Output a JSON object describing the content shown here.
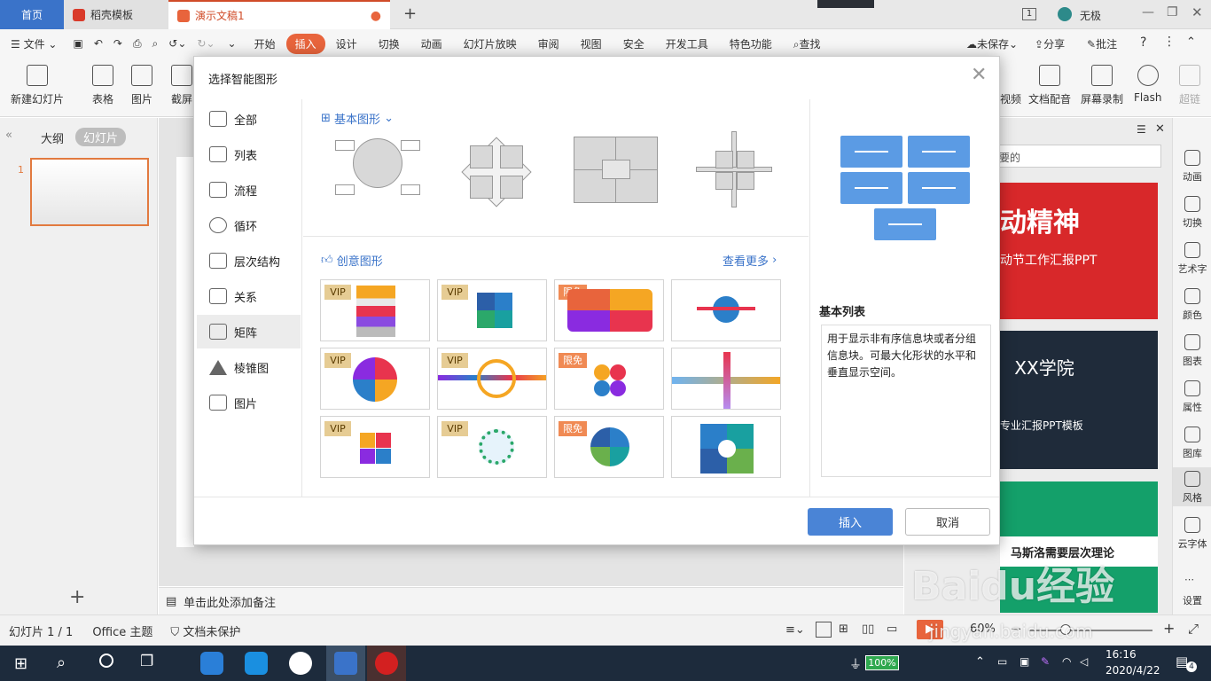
{
  "tabs": {
    "home": "首页",
    "docer": "稻壳模板",
    "doc": "演示文稿1",
    "user": "无极"
  },
  "menu": {
    "file": "文件",
    "items": [
      "开始",
      "插入",
      "设计",
      "切换",
      "动画",
      "幻灯片放映",
      "审阅",
      "视图",
      "安全",
      "开发工具",
      "特色功能"
    ],
    "search": "查找",
    "unsaved": "未保存",
    "share": "分享",
    "comment": "批注"
  },
  "ribbon": {
    "new_slide": "新建幻灯片",
    "table": "表格",
    "picture": "图片",
    "screenshot": "截屏",
    "video": "视频",
    "doc_voice": "文档配音",
    "screen_rec": "屏幕录制",
    "flash": "Flash",
    "super": "超链"
  },
  "left_panel": {
    "outline": "大纲",
    "slides": "幻灯片",
    "slide_no": "1"
  },
  "notes": "单击此处添加备注",
  "right_sidebar": [
    "动画",
    "切换",
    "艺术字",
    "颜色",
    "图表",
    "属性",
    "图库",
    "风格",
    "云字体",
    "设置"
  ],
  "right_panel": {
    "search_placeholder": "要的",
    "banner1_title": "动精神",
    "banner1_sub": "动节工作汇报PPT",
    "banner2_title": "XX学院",
    "banner2_sub": "专业汇报PPT模板",
    "banner3_title": "马斯洛需要层次理论"
  },
  "status": {
    "slide_count": "幻灯片 1 / 1",
    "theme": "Office 主题",
    "protect": "文档未保护",
    "zoom": "60%"
  },
  "taskbar": {
    "battery": "100%",
    "time": "16:16",
    "date": "2020/4/22",
    "notify": "4"
  },
  "dialog": {
    "title": "选择智能图形",
    "categories": [
      "全部",
      "列表",
      "流程",
      "循环",
      "层次结构",
      "关系",
      "矩阵",
      "棱锥图",
      "图片"
    ],
    "basic_header": "基本图形",
    "creative_header": "创意图形",
    "see_more": "查看更多",
    "vip": "VIP",
    "free": "限免",
    "desc_title": "基本列表",
    "desc_text": "用于显示非有序信息块或者分组信息块。可最大化形状的水平和垂直显示空间。",
    "insert": "插入",
    "cancel": "取消"
  },
  "watermark": {
    "brand": "Baidu经验",
    "url": "jingyan.baidu.com"
  }
}
